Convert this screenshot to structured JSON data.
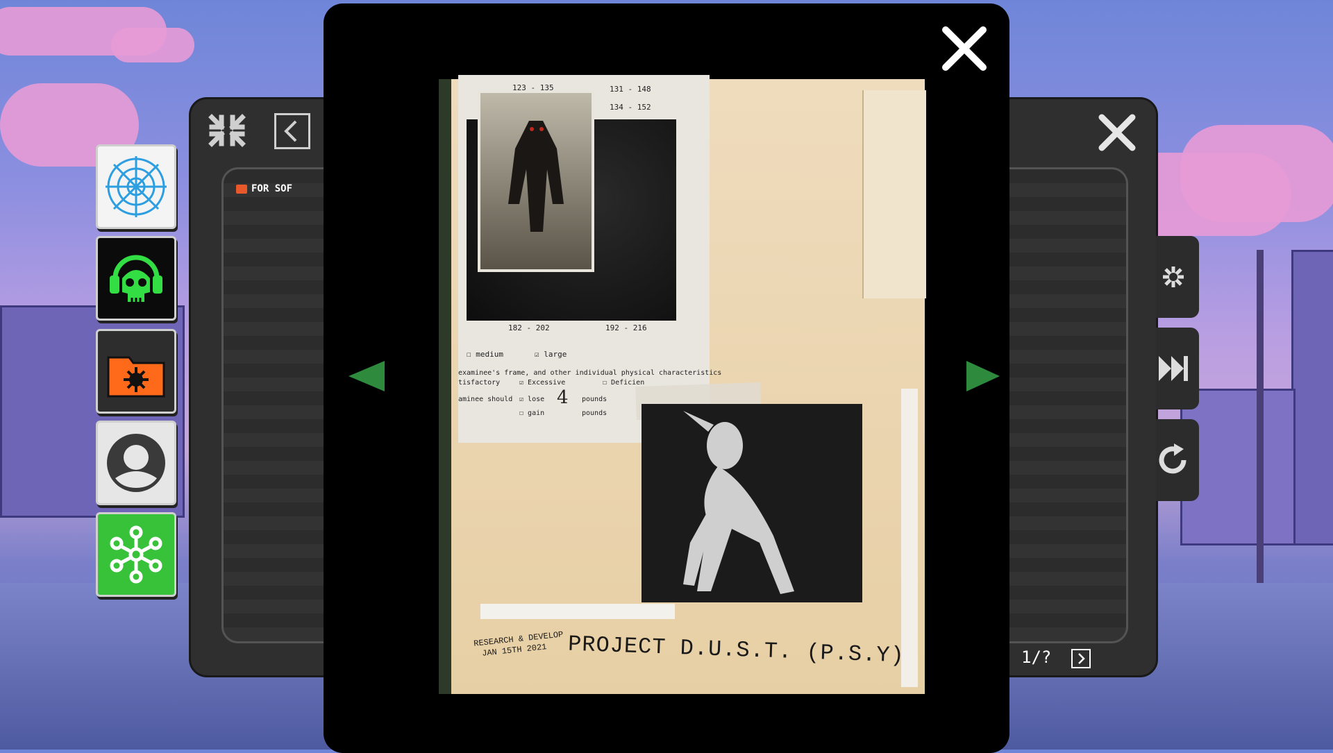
{
  "left_window": {
    "folder_label": "FOR SOF"
  },
  "right_window": {
    "pagination": "1/?"
  },
  "dock_icons": [
    {
      "name": "web-icon",
      "color": "#ffffff"
    },
    {
      "name": "skull-headphones-icon",
      "color": "#000000"
    },
    {
      "name": "virus-folder-icon",
      "color": "#ff6a1a"
    },
    {
      "name": "user-profile-icon",
      "color": "#ffffff"
    },
    {
      "name": "network-nodes-icon",
      "color": "#33cc33"
    }
  ],
  "viewer": {
    "document": {
      "tab_labels": [
        "123 - 135",
        "131 - 148",
        "134 - 152",
        "182 - 202",
        "192 - 216"
      ],
      "checkbox_medium": "medium",
      "checkbox_large": "large",
      "form_line1": "examinee's frame, and other individual physical characteristics",
      "form_line2": "tisfactory",
      "checkbox_excessive": "Excessive",
      "checkbox_deficient": "Deficien",
      "form_line3": "aminee should",
      "checkbox_lose": "lose",
      "lose_amount": "4",
      "pounds_1": "pounds",
      "checkbox_gain": "gain",
      "pounds_2": "pounds",
      "stamp_small_1": "RESEARCH & DEVELOP",
      "stamp_small_2": "JAN 15TH 2021",
      "stamp_title": "PROJECT D.U.S.T. (P.S.Y)"
    }
  },
  "colors": {
    "accent_green": "#3a8d3a",
    "panel_bg": "#2f2f2f",
    "viewer_bg": "#000000",
    "paper": "#ecd8b4"
  }
}
